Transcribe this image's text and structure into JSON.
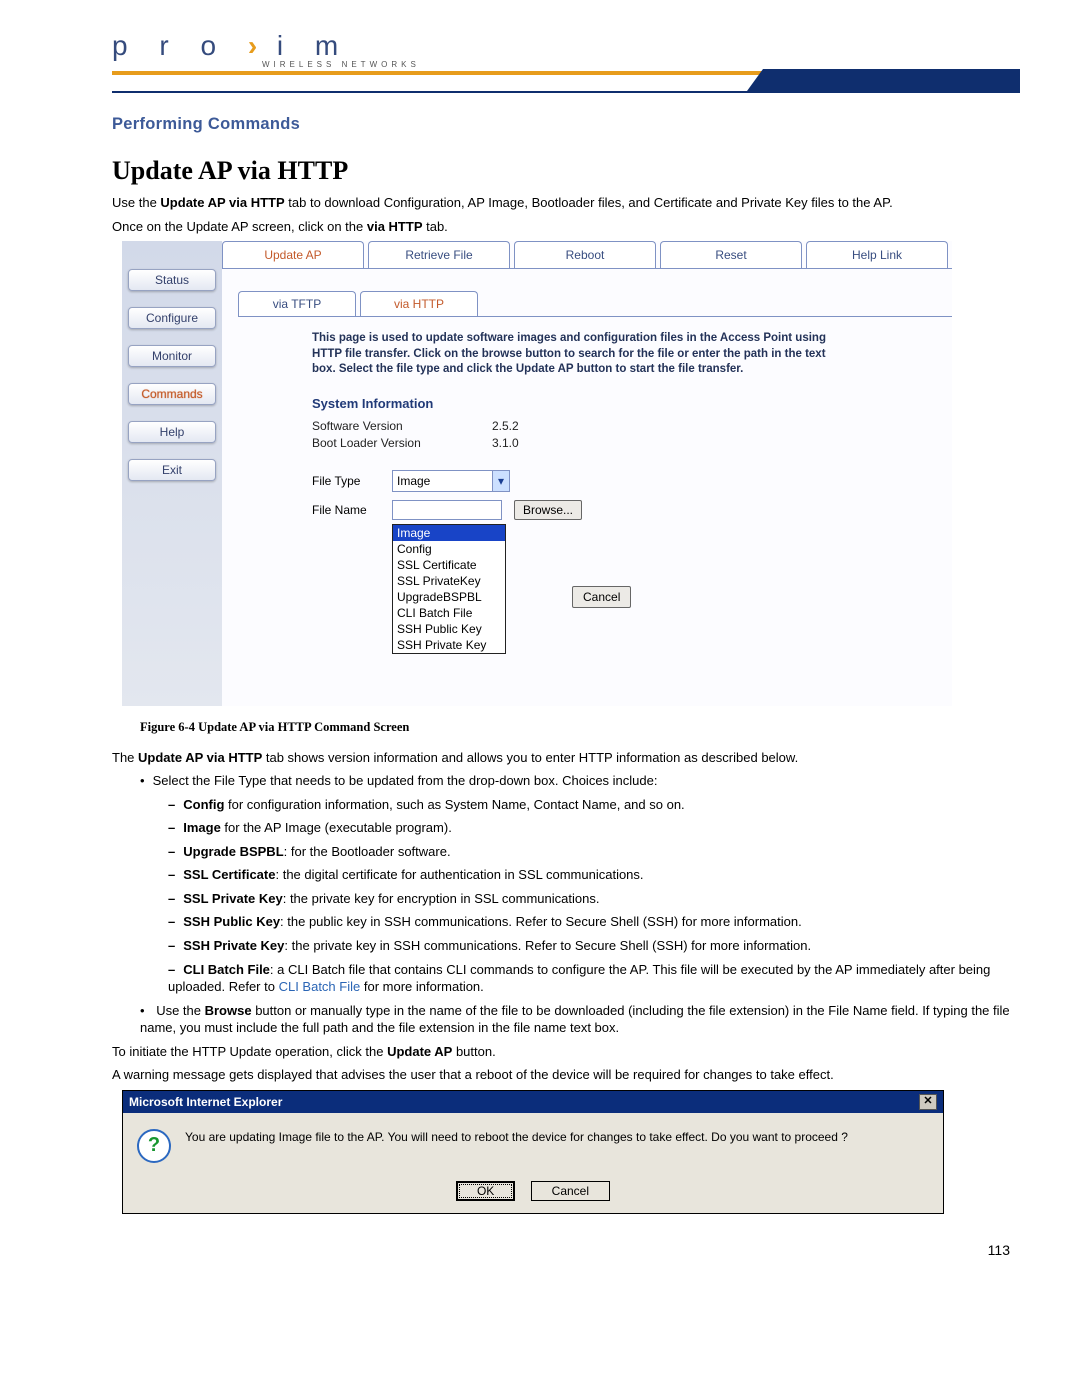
{
  "header": {
    "logo_text": "proxim",
    "logo_sub": "WIRELESS NETWORKS",
    "section": "Performing Commands"
  },
  "title": "Update AP via HTTP",
  "intro": {
    "p1_a": "Use the ",
    "p1_b": "Update AP via HTTP",
    "p1_c": " tab to download Configuration, AP Image, Bootloader files, and Certificate and Private Key files to the AP.",
    "p2_a": "Once on the Update AP screen, click on the ",
    "p2_b": "via HTTP",
    "p2_c": " tab."
  },
  "shot1": {
    "sidebar": [
      "Status",
      "Configure",
      "Monitor",
      "Commands",
      "Help",
      "Exit"
    ],
    "sidebar_active_index": 3,
    "toptabs": [
      "Update AP",
      "Retrieve File",
      "Reboot",
      "Reset",
      "Help Link"
    ],
    "toptabs_active_index": 0,
    "subtabs": [
      "via TFTP",
      "via HTTP"
    ],
    "subtabs_active_index": 1,
    "help": "This page is used to update software images and configuration files in the Access Point using HTTP file transfer. Click on the browse button to search for the file or enter the path in the text box. Select the file type and click the Update AP button to start the file transfer.",
    "sysinfo_head": "System Information",
    "sysinfo": [
      {
        "k": "Software Version",
        "v": "2.5.2"
      },
      {
        "k": "Boot Loader Version",
        "v": "3.1.0"
      }
    ],
    "file_type_label": "File Type",
    "file_name_label": "File Name",
    "file_type_value": "Image",
    "file_type_options": [
      "Image",
      "Config",
      "SSL Certificate",
      "SSL PrivateKey",
      "UpgradeBSPBL",
      "CLI Batch File",
      "SSH Public Key",
      "SSH Private Key"
    ],
    "browse_btn": "Browse...",
    "cancel_btn": "Cancel"
  },
  "figcaption": "Figure 6-4    Update AP via HTTP Command Screen",
  "desc": {
    "p1_a": "The ",
    "p1_b": "Update AP via HTTP",
    "p1_c": " tab shows version information and allows you to enter HTTP information as described below.",
    "b1": "Select the File Type that needs to be updated from the drop-down box. Choices include:",
    "opts": [
      {
        "b": "Config",
        "t": " for configuration information, such as System Name, Contact Name, and so on."
      },
      {
        "b": "Image",
        "t": " for the AP Image (executable program)."
      },
      {
        "b": "Upgrade BSPBL",
        "t": ": for the Bootloader software."
      },
      {
        "b": "SSL Certificate",
        "t": ": the digital certificate for authentication in SSL communications."
      },
      {
        "b": "SSL Private Key",
        "t": ": the private key for encryption in SSL communications."
      },
      {
        "b": "SSH Public Key",
        "t": ": the public key in SSH communications. Refer to Secure Shell (SSH) for more information."
      },
      {
        "b": "SSH Private Key",
        "t": ": the private key in SSH communications. Refer to Secure Shell (SSH) for more information."
      },
      {
        "b": "CLI Batch File",
        "t": ": a CLI Batch file that contains CLI commands to configure the AP. This file will be executed by the AP immediately after being uploaded. Refer to ",
        "link": "CLI Batch File",
        "t2": " for more information."
      }
    ],
    "b2_a": "Use the ",
    "b2_b": "Browse",
    "b2_c": " button or manually type in the name of the file to be downloaded (including the file extension) in the File Name field. If typing the file name, you must include the full path and the file extension in the file name text box.",
    "b3_a": "To initiate the HTTP Update operation, click the ",
    "b3_b": "Update AP",
    "b3_c": " button.",
    "b4": "A warning message gets displayed that advises the user that a reboot of the device will be required for changes to take effect."
  },
  "dialog": {
    "title": "Microsoft Internet Explorer",
    "msg": "You are updating Image file to the AP. You will need to reboot the device for changes to take effect. Do you want to proceed ?",
    "ok": "OK",
    "cancel": "Cancel"
  },
  "page_number": "113"
}
